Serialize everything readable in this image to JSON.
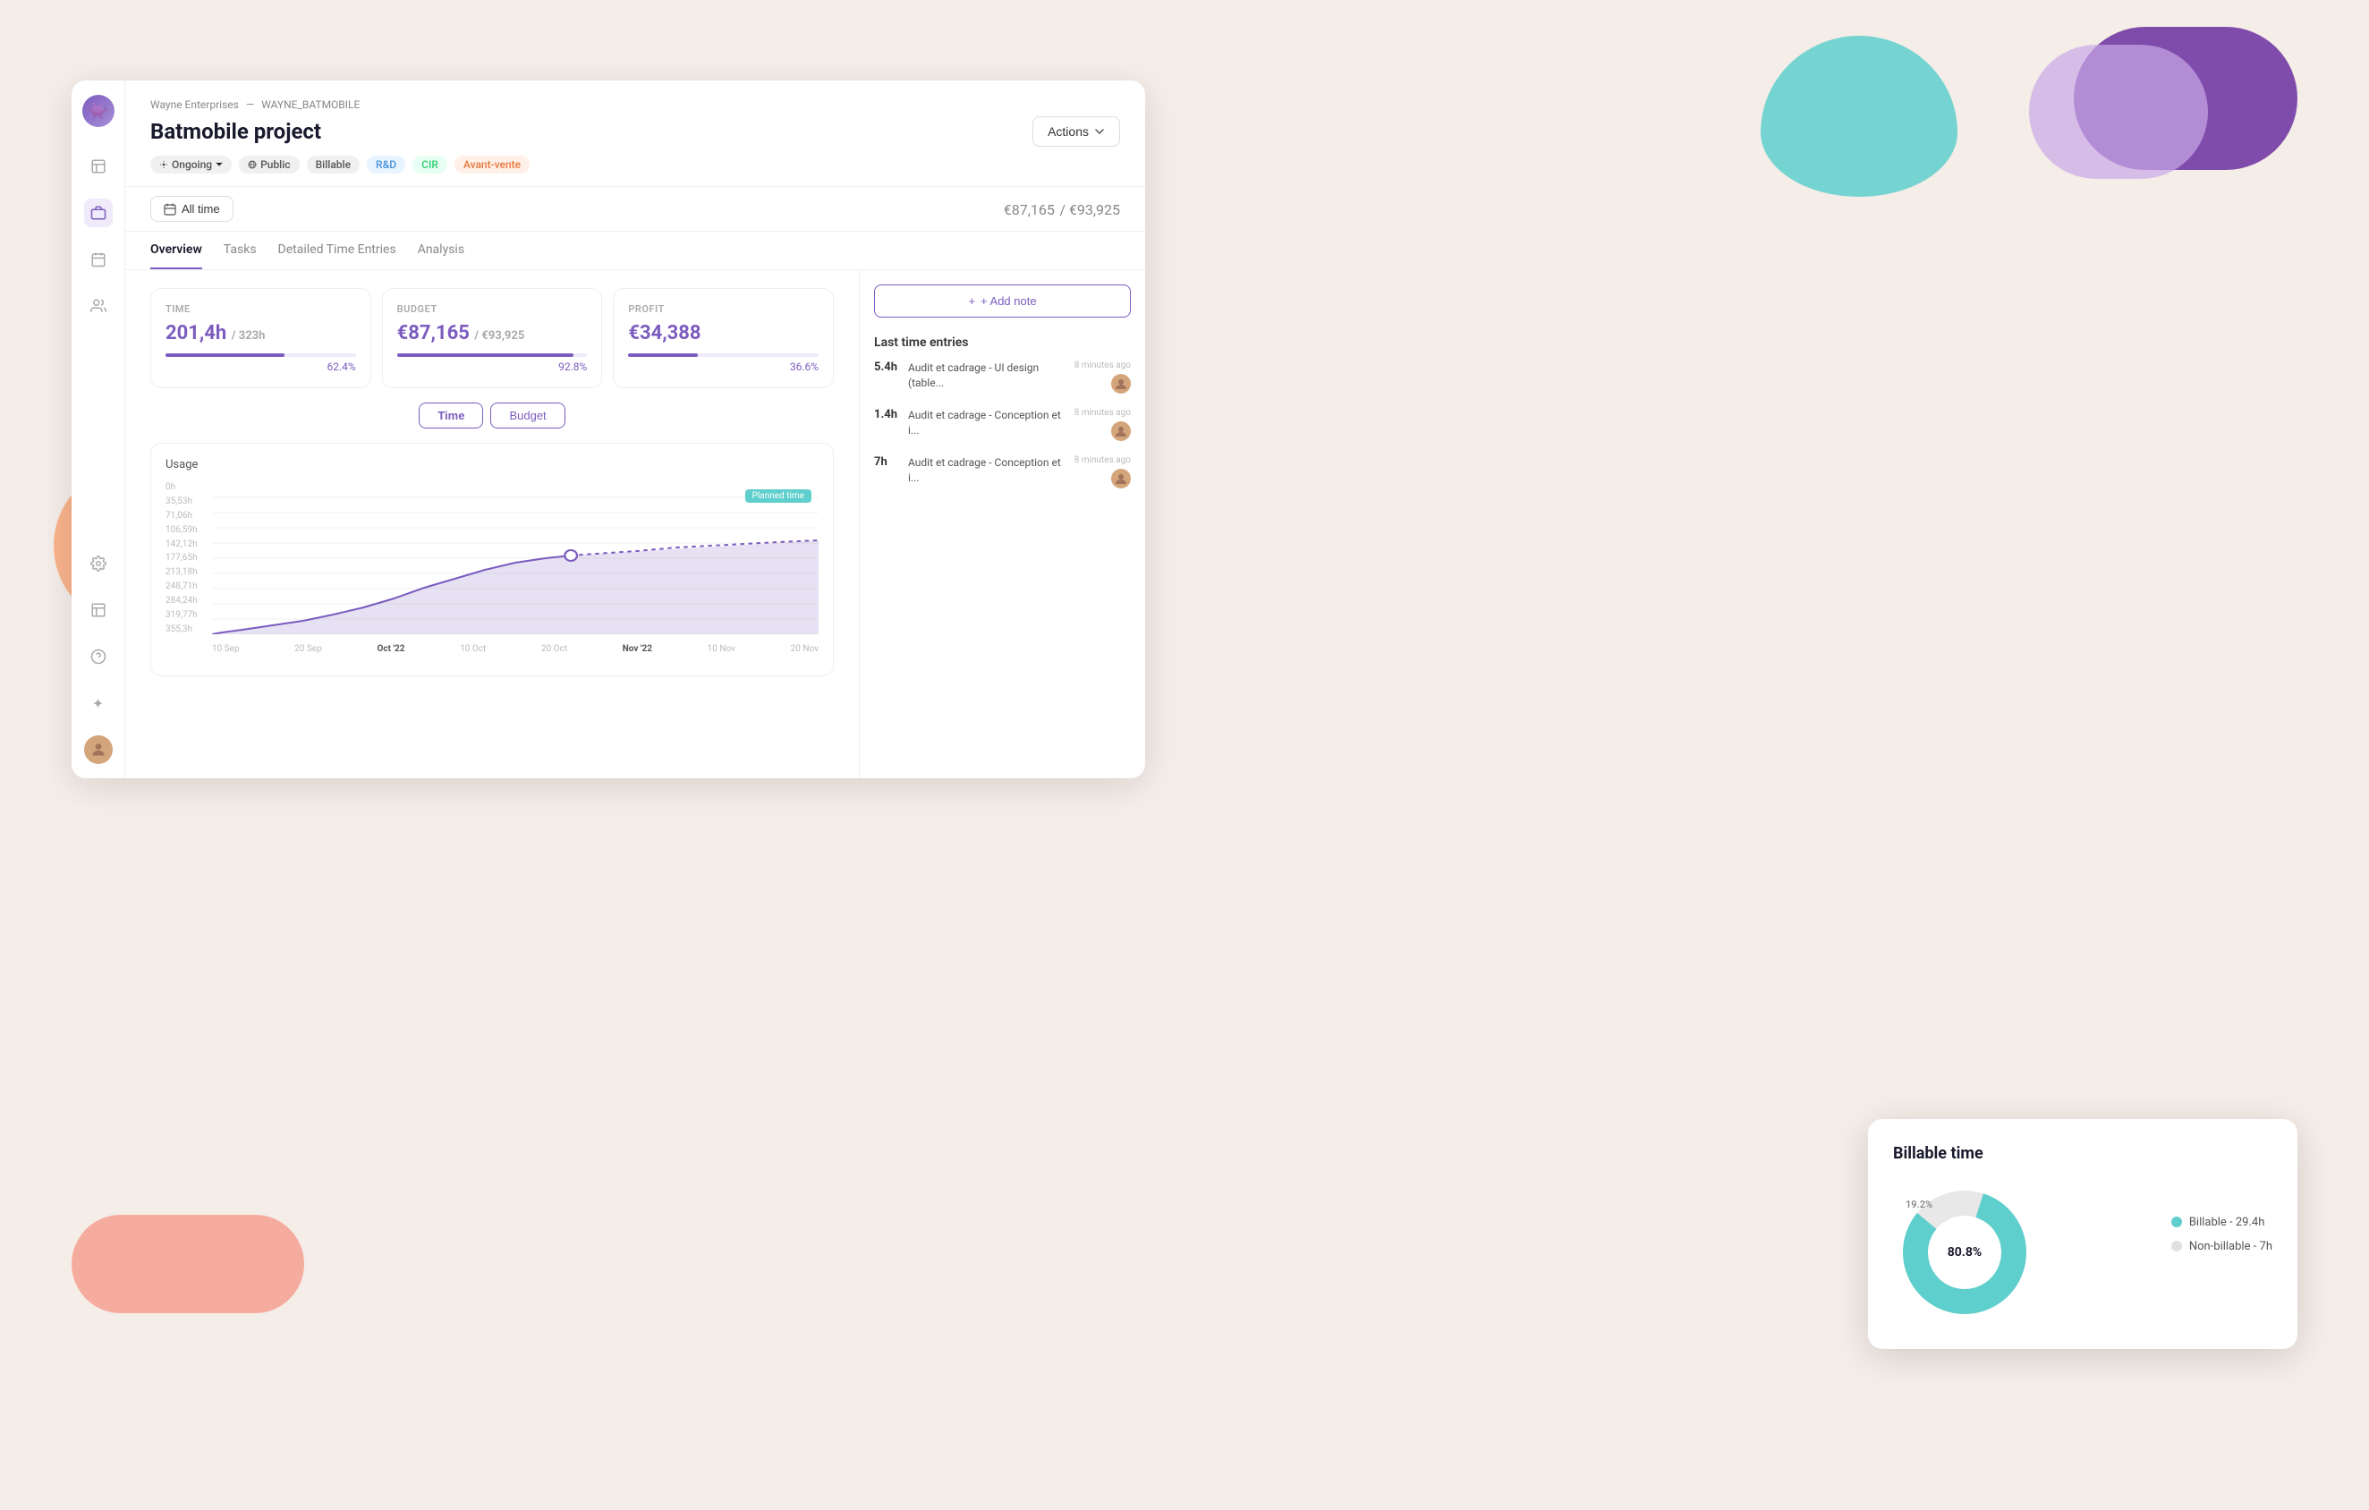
{
  "app": {
    "background": "#f5ede8"
  },
  "breadcrumb": {
    "company": "Wayne Enterprises",
    "separator": "—",
    "project_code": "WAYNE_BATMOBILE"
  },
  "header": {
    "title": "Batmobile project",
    "actions_label": "Actions"
  },
  "tags": [
    {
      "id": "ongoing",
      "label": "Ongoing",
      "type": "ongoing"
    },
    {
      "id": "public",
      "label": "Public",
      "type": "public"
    },
    {
      "id": "billable",
      "label": "Billable",
      "type": "billable"
    },
    {
      "id": "rd",
      "label": "R&D",
      "type": "rd"
    },
    {
      "id": "cir",
      "label": "CIR",
      "type": "cir"
    },
    {
      "id": "avant",
      "label": "Avant-vente",
      "type": "avant"
    }
  ],
  "date_filter": {
    "label": "All time"
  },
  "total": {
    "current": "€87,165",
    "separator": "/",
    "max": "€93,925"
  },
  "tabs": [
    {
      "id": "overview",
      "label": "Overview",
      "active": true
    },
    {
      "id": "tasks",
      "label": "Tasks",
      "active": false
    },
    {
      "id": "time_entries",
      "label": "Detailed Time Entries",
      "active": false
    },
    {
      "id": "analysis",
      "label": "Analysis",
      "active": false
    }
  ],
  "stats": [
    {
      "id": "time",
      "label": "TIME",
      "value": "201,4h",
      "sub": "/ 323h",
      "pct": "62.4%",
      "fill": 62.4
    },
    {
      "id": "budget",
      "label": "BUDGET",
      "value": "€87,165",
      "sub": "/ €93,925",
      "pct": "92.8%",
      "fill": 92.8
    },
    {
      "id": "profit",
      "label": "PROFIT",
      "value": "€34,388",
      "sub": "",
      "pct": "36.6%",
      "fill": 36.6
    }
  ],
  "toggle": {
    "time_label": "Time",
    "budget_label": "Budget"
  },
  "chart": {
    "title": "Usage",
    "planned_badge": "Planned time",
    "y_labels": [
      "0h",
      "35,53h",
      "71,06h",
      "106,59h",
      "142,12h",
      "177,65h",
      "213,18h",
      "248,71h",
      "284,24h",
      "319,77h",
      "355,3h"
    ],
    "x_labels": [
      "10 Sep",
      "20 Sep",
      "Oct '22",
      "10 Oct",
      "20 Oct",
      "Nov '22",
      "10 Nov",
      "20 Nov"
    ]
  },
  "right_panel": {
    "add_note_label": "+ Add note",
    "last_entries_title": "Last time entries",
    "entries": [
      {
        "hours": "5.4h",
        "description": "Audit et cadrage - UI design (table...",
        "time_ago": "8 minutes ago"
      },
      {
        "hours": "1.4h",
        "description": "Audit et cadrage - Conception et i...",
        "time_ago": "8 minutes ago"
      },
      {
        "hours": "7h",
        "description": "Audit et cadrage - Conception et i...",
        "time_ago": "8 minutes ago"
      }
    ]
  },
  "billable_card": {
    "title": "Billable time",
    "billable_label": "Billable - 29.4h",
    "nonbillable_label": "Non-billable - 7h",
    "billable_pct": "80.8%",
    "nonbillable_pct": "19.2%",
    "billable_value": 80.8,
    "nonbillable_value": 19.2
  },
  "sidebar": {
    "icons": [
      {
        "id": "logo",
        "symbol": "👾"
      },
      {
        "id": "profile",
        "symbol": "👤"
      },
      {
        "id": "briefcase",
        "symbol": "💼"
      },
      {
        "id": "calendar",
        "symbol": "📅"
      },
      {
        "id": "team",
        "symbol": "👥"
      },
      {
        "id": "settings",
        "symbol": "⚙"
      },
      {
        "id": "table",
        "symbol": "📋"
      },
      {
        "id": "help",
        "symbol": "?"
      },
      {
        "id": "sparkle",
        "symbol": "✦"
      },
      {
        "id": "avatar",
        "symbol": "😊"
      }
    ]
  }
}
